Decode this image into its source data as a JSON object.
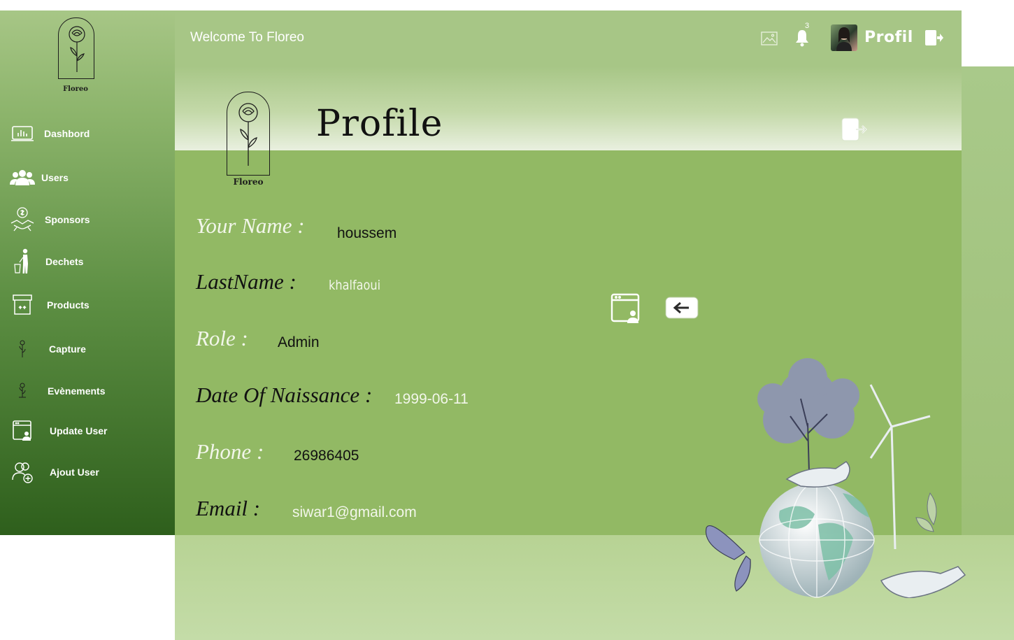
{
  "sidebar": {
    "logo_caption": "Floreo",
    "items": [
      {
        "label": "Dashbord",
        "icon": "dashboard-icon"
      },
      {
        "label": "Users",
        "icon": "users-icon"
      },
      {
        "label": "Sponsors",
        "icon": "sponsors-icon"
      },
      {
        "label": "Dechets",
        "icon": "waste-icon"
      },
      {
        "label": "Products",
        "icon": "products-icon"
      },
      {
        "label": "Capture",
        "icon": "capture-icon"
      },
      {
        "label": "Evènements",
        "icon": "events-icon"
      },
      {
        "label": "Update User",
        "icon": "update-user-icon"
      },
      {
        "label": "Ajout User",
        "icon": "add-user-icon"
      }
    ]
  },
  "topbar": {
    "welcome": "Welcome To Floreo",
    "notification_count": "3",
    "profile_label": "Profil"
  },
  "page": {
    "title": "Profile",
    "logo_caption": "Floreo"
  },
  "profile": {
    "fields": [
      {
        "label": "Your Name :",
        "value": "houssem"
      },
      {
        "label": "LastName :",
        "value": "khalfaoui"
      },
      {
        "label": "Role :",
        "value": "Admin"
      },
      {
        "label": "Date Of Naissance :",
        "value": "1999-06-11"
      },
      {
        "label": "Phone :",
        "value": "26986405"
      },
      {
        "label": "Email :",
        "value": "siwar1@gmail.com"
      }
    ]
  },
  "colors": {
    "sidebar_top": "#a7c686",
    "sidebar_bottom": "#2e5f1c",
    "panel": "#92b964",
    "label_light": "#f2f6ea",
    "label_dark": "#111111"
  }
}
